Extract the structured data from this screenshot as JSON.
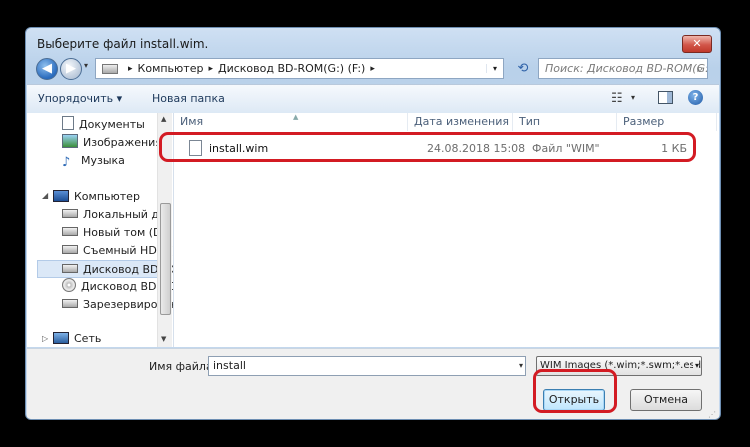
{
  "window": {
    "title": "Выберите файл install.wim.",
    "close": "✕"
  },
  "nav": {
    "back": "◀",
    "forward": "▶",
    "history": "▾"
  },
  "address": {
    "crumbs": [
      "Компьютер",
      "Дисковод BD-ROM(G:) (F:)"
    ],
    "separator": "▸",
    "dropdown": "▾"
  },
  "refresh": "⟲",
  "search": {
    "placeholder": "Поиск: Дисковод BD-ROM(G:) (F:)",
    "icon": "search-icon"
  },
  "toolbar": {
    "organize": "Упорядочить ▾",
    "new_folder": "Новая папка",
    "view_dropdown": "▾",
    "help": "?"
  },
  "sidebar": {
    "items": [
      {
        "label": "Документы",
        "icon": "document-icon"
      },
      {
        "label": "Изображения",
        "icon": "pictures-icon"
      },
      {
        "label": "Музыка",
        "icon": "music-icon"
      },
      {
        "label": "Компьютер",
        "icon": "computer-icon"
      },
      {
        "label": "Локальный диск",
        "icon": "local-disk-icon"
      },
      {
        "label": "Новый том (D:)",
        "icon": "drive-icon"
      },
      {
        "label": "Съемный HDD (",
        "icon": "drive-icon"
      },
      {
        "label": "Дисковод BD-RO",
        "icon": "drive-icon",
        "selected": true
      },
      {
        "label": "Дисковод BD-RO",
        "icon": "cd-icon"
      },
      {
        "label": "Зарезервирован",
        "icon": "drive-icon"
      },
      {
        "label": "Сеть",
        "icon": "network-icon"
      }
    ]
  },
  "file_list": {
    "columns": [
      "Имя",
      "Дата изменения",
      "Тип",
      "Размер"
    ],
    "rows": [
      {
        "name": "install.wim",
        "date": "24.08.2018 15:08",
        "type": "Файл \"WIM\"",
        "size": "1 КБ"
      }
    ]
  },
  "footer": {
    "filename_label": "Имя файла:",
    "filename_value": "install",
    "filter_value": "WIM Images (*.wim;*.swm;*.esd)",
    "open_button": "Открыть",
    "cancel_button": "Отмена"
  },
  "colors": {
    "highlight": "#d31b23",
    "selection": "#dbe8f7"
  }
}
